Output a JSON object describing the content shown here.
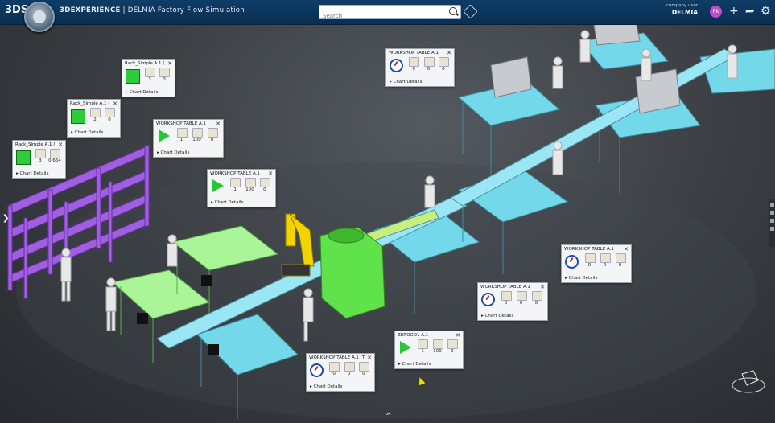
{
  "header": {
    "logo": "3DS",
    "app_title_brand": "3DEXPERIENCE",
    "app_title_rest": " | DELMIA Factory Flow Simulation",
    "search_placeholder": "Search",
    "user_name": "company user",
    "platform": "DELMIA",
    "avatar_initials": "PK",
    "icons": [
      "add-icon",
      "share-icon",
      "settings-icon",
      "search-icon",
      "tag-icon"
    ]
  },
  "cards": [
    {
      "title": "Rack_Simple A.1 (",
      "indicator": "green",
      "values": [
        "3",
        "0"
      ],
      "details": "Chart Details"
    },
    {
      "title": "Rack_Simple A.1 (",
      "indicator": "green",
      "values": [
        "2",
        "0"
      ],
      "details": "Chart Details"
    },
    {
      "title": "Rack_Simple A.1 (",
      "indicator": "green",
      "values": [
        "3",
        "0.664"
      ],
      "details": "Chart Details"
    },
    {
      "title": "WORKSHOP TABLE A.1",
      "indicator": "play",
      "values": [
        "1",
        "100",
        "0"
      ],
      "details": "Chart Details"
    },
    {
      "title": "WORKSHOP TABLE A.1",
      "indicator": "play",
      "values": [
        "1",
        "100",
        "0"
      ],
      "details": "Chart Details"
    },
    {
      "title": "WORKSHOP TABLE A.1",
      "indicator": "clock",
      "values": [
        "0",
        "0",
        "0"
      ],
      "details": "Chart Details"
    },
    {
      "title": "WORKSHOP TABLE A.1",
      "indicator": "clock",
      "values": [
        "0",
        "0",
        "0"
      ],
      "details": "Chart Details"
    },
    {
      "title": "WORKSHOP TABLE A.1",
      "indicator": "clock",
      "values": [
        "0",
        "0",
        "0"
      ],
      "details": "Chart Details"
    },
    {
      "title": "ZEROOO1 A.1",
      "indicator": "play",
      "values": [
        "1",
        "100",
        "0"
      ],
      "details": "Chart Details"
    },
    {
      "title": "WORKSHOP TABLE A.1 (T",
      "indicator": "clock",
      "values": [
        "0",
        "0",
        "0"
      ],
      "details": "Chart Details"
    }
  ],
  "colors": {
    "topbar": "#0a2f52",
    "rack": "#9b59d6",
    "table_green": "#9ef08a",
    "table_cyan": "#6fd6e6",
    "conveyor": "#8fe0f0",
    "robot": "#f5d800",
    "machine": "#5ee04a"
  }
}
